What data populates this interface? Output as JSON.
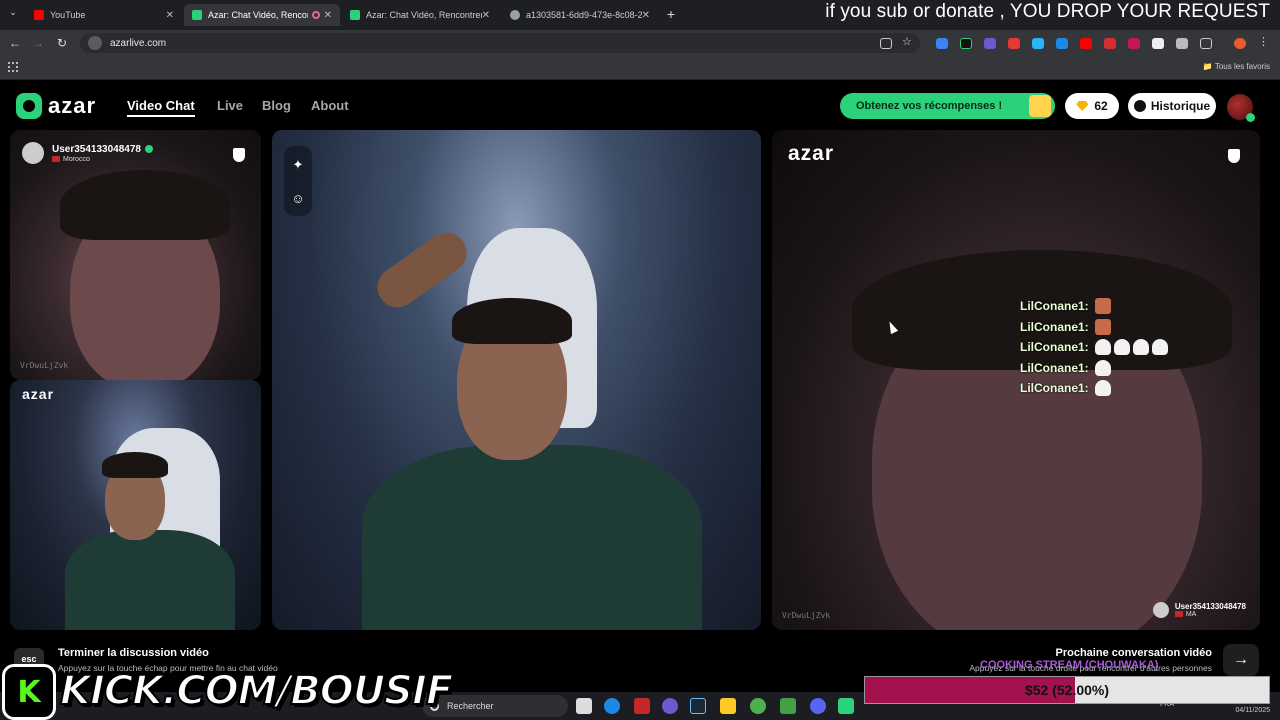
{
  "browser": {
    "tabs": [
      {
        "title": "YouTube",
        "icon_color": "#ff0000",
        "active": false
      },
      {
        "title": "Azar: Chat Vidéo, Rencontr",
        "icon_color": "#2bd27b",
        "active": true
      },
      {
        "title": "Azar: Chat Vidéo, Rencontrer d",
        "icon_color": "#2bd27b",
        "active": false
      },
      {
        "title": "a1303581-6dd9-473e-8c08-2d",
        "icon_color": "#9aa0a6",
        "active": false
      }
    ],
    "url": "azarlive.com",
    "bookmarks_label": "Tous les favoris"
  },
  "stream_overlay": {
    "top_banner": "if you sub or donate , YOU DROP YOUR REQUEST",
    "kick_letter": "K",
    "kick_channel": "KICK.COM/BOUSIF",
    "goal_text": "$52 (52.00%)",
    "goal_fraction": 0.52,
    "cooking_text": "COOKING STREAM (CHOUWAKA)"
  },
  "azar": {
    "logo": "azar",
    "nav": [
      "Video Chat",
      "Live",
      "Blog",
      "About"
    ],
    "rewards_button": "Obtenez vos récompenses !",
    "gems": "62",
    "history_button": "Historique",
    "peer_user": "User354133048478",
    "peer_country": "Morocco",
    "peer_country_short": "MA",
    "watermark_id": "VrDwuLjZvk",
    "chat_lines": [
      {
        "user": "LilConane1:",
        "emotes": [
          "face"
        ]
      },
      {
        "user": "LilConane1:",
        "emotes": [
          "face"
        ]
      },
      {
        "user": "LilConane1:",
        "emotes": [
          "mask",
          "mask",
          "mask",
          "mask"
        ]
      },
      {
        "user": "LilConane1:",
        "emotes": [
          "mask"
        ]
      },
      {
        "user": "LilConane1:",
        "emotes": [
          "mask"
        ]
      }
    ],
    "esc_key": "esc",
    "end_title": "Terminer la discussion vidéo",
    "end_hint": "Appuyez sur la touche échap pour mettre fin au chat vidéo",
    "next_title": "Prochaine conversation vidéo",
    "next_hint": "Appuyez sur la touche droite pour rencontrer d'autres personnes",
    "next_arrow": "→"
  },
  "taskbar": {
    "search_placeholder": "Rechercher",
    "lang": "FRA",
    "date": "04/11/2025"
  }
}
